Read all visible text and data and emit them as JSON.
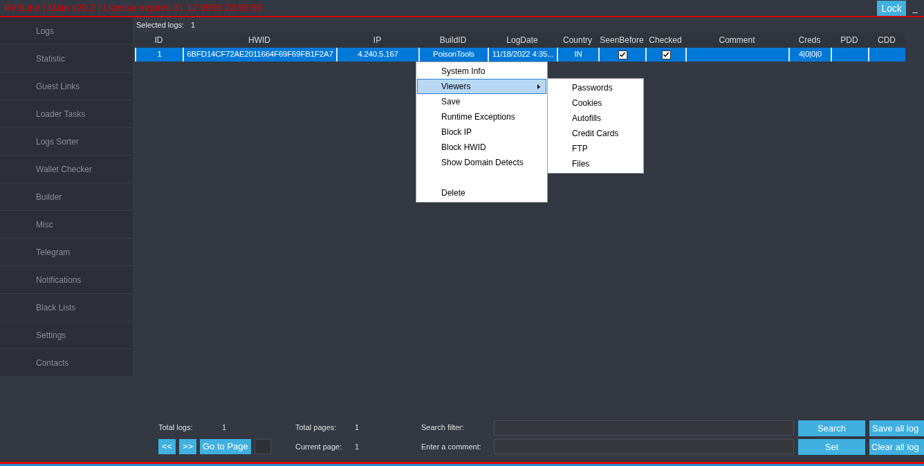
{
  "window": {
    "title": "RedLine | Main v20.2 | License expires 31.12.9999 23:59:59",
    "lock_button": "Lock",
    "minimize": "_"
  },
  "sidebar": {
    "items": [
      "Logs",
      "Statistic",
      "Guest Links",
      "Loader Tasks",
      "Logs Sorter",
      "Wallet Checker",
      "Builder",
      "Misc",
      "Telegram",
      "Notifications",
      "Black Lists",
      "Settings",
      "Contacts"
    ]
  },
  "selected_logs": {
    "label": "Selected logs:",
    "value": "1"
  },
  "table": {
    "columns": [
      "ID",
      "HWID",
      "IP",
      "BuildID",
      "LogDate",
      "Country",
      "SeenBefore",
      "Checked",
      "Comment",
      "Creds",
      "PDD",
      "CDD"
    ],
    "rows": [
      {
        "selected": true,
        "id": "1",
        "hwid": "6BFD14CF72AE2011664F69F69FB1F2A7",
        "ip": "4.240.5.167",
        "build_id": "PoisonTools",
        "log_date": "11/18/2022 4:35...",
        "country": "IN",
        "seen_before": true,
        "checked": true,
        "creds": "4|0|0|0"
      }
    ]
  },
  "context_menu": {
    "items": [
      {
        "kind": "item",
        "label": "System Info",
        "selected": false,
        "has_submenu": false
      },
      {
        "kind": "item",
        "label": "Viewers",
        "selected": true,
        "has_submenu": true
      },
      {
        "kind": "item",
        "label": "Save",
        "selected": false,
        "has_submenu": false
      },
      {
        "kind": "item",
        "label": "Runtime Exceptions",
        "selected": false,
        "has_submenu": false
      },
      {
        "kind": "item",
        "label": "Block IP",
        "selected": false,
        "has_submenu": false
      },
      {
        "kind": "item",
        "label": "Block HWID",
        "selected": false,
        "has_submenu": false
      },
      {
        "kind": "item",
        "label": "Show Domain Detects",
        "selected": false,
        "has_submenu": false
      },
      {
        "kind": "spacer"
      },
      {
        "kind": "item",
        "label": "Delete",
        "selected": false,
        "has_submenu": false
      }
    ],
    "submenu": [
      "Passwords",
      "Cookies",
      "Autofills",
      "Credit Cards",
      "FTP",
      "Files"
    ]
  },
  "footer": {
    "total_logs": {
      "label": "Total logs:",
      "value": "1"
    },
    "prev": "<<",
    "next": ">>",
    "go_to_page": "Go to Page",
    "total_pages": {
      "label": "Total pages:",
      "value": "1"
    },
    "current_page": {
      "label": "Current page:",
      "value": "1"
    },
    "search_filter": "Search filter:",
    "enter_comment": "Enter a comment:",
    "search_button": "Search",
    "set_button": "Set",
    "save_all": "Save all log",
    "clear_all": "Clear all log"
  }
}
